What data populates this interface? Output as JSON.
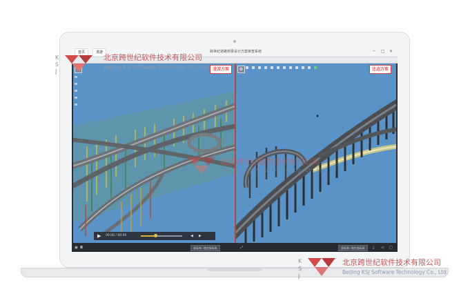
{
  "titlebar": {
    "title": "跨世纪道路桥梁设计方案审查系统",
    "tabs": [
      "首页",
      "漫游"
    ],
    "window_buttons": [
      "─",
      "□",
      "✕"
    ]
  },
  "left_pane": {
    "mode_tag": "漫游方案",
    "playbar": {
      "play_icon": "▶",
      "time": "00:00 / 00:00",
      "progress": 0.35,
      "controls": [
        "◀",
        "▶"
      ]
    }
  },
  "right_pane": {
    "mode_tag": "比选方案"
  },
  "statusbar": {
    "left_box": "坐标系: 地方坐标系",
    "right_box": "坐标系: 地方坐标系",
    "icons": [
      "save-icon",
      "camera-icon",
      "fullscreen-icon"
    ]
  },
  "watermark": {
    "company_cn": "北京跨世纪软件技术有限公司",
    "company_en": "Beijing KSJ Software Technology Co., Ltd."
  },
  "colors": {
    "sky": "#5a93c7",
    "accent_red": "#d11",
    "divider": "#b04a3a"
  }
}
